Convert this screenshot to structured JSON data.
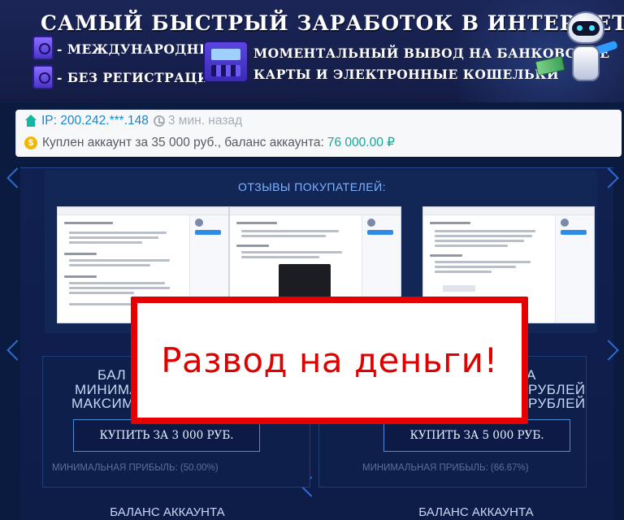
{
  "banner": {
    "title": "САМЫЙ БЫСТРЫЙ ЗАРАБОТОК В ИНТЕРНЕТЕ",
    "left_line1": "- МЕЖДУНАРОДНЫЙ",
    "left_line2": "- БЕЗ РЕГИСТРАЦИИ",
    "right_line1": "МОМЕНТАЛЬНЫЙ ВЫВОД НА БАНКОВСКИЕ",
    "right_line2": "КАРТЫ И ЭЛЕКТРОННЫЕ КОШЕЛЬКИ"
  },
  "notification": {
    "ip": "IP: 200.242.***.148",
    "time": "3 мин. назад",
    "purchase": "Куплен аккаунт за 35 000 руб., баланс аккаунта:",
    "balance": "76 000.00 ₽",
    "coin_symbol": "$"
  },
  "reviews": {
    "title": "ОТЗЫВЫ ПОКУПАТЕЛЕЙ:"
  },
  "plans": [
    {
      "title_partial": "БАЛ",
      "min_partial": "МИНИМАЛ",
      "max_partial": "МАКСИМА",
      "button": "КУПИТЬ ЗА 3 000 РУБ.",
      "profit": "МИНИМАЛЬНАЯ ПРИБЫЛЬ: (50.00%)"
    },
    {
      "title_partial": "А",
      "min_partial": "РУБЛЕЙ",
      "max_partial": "РУБЛЕЙ",
      "button": "КУПИТЬ ЗА 5 000 РУБ.",
      "profit": "МИНИМАЛЬНАЯ ПРИБЫЛЬ: (66.67%)"
    }
  ],
  "bottom_labels": [
    "БАЛАНС АККАУНТА",
    "БАЛАНС АККАУНТА"
  ],
  "overlay": {
    "text": "Развод на деньги!"
  }
}
